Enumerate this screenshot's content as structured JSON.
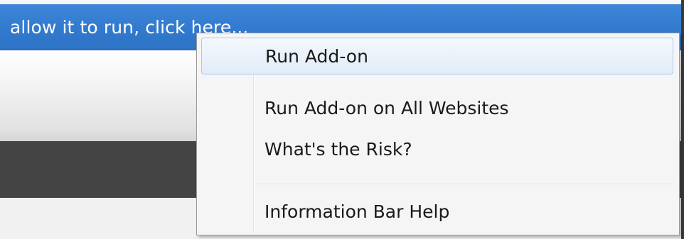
{
  "info_bar": {
    "text": "allow it to run, click here..."
  },
  "context_menu": {
    "items": [
      {
        "label": "Run Add-on"
      },
      {
        "label": "Run Add-on on All Websites"
      },
      {
        "label": "What's the Risk?"
      },
      {
        "label": "Information Bar Help"
      }
    ]
  },
  "colors": {
    "info_bar": "#3179cd",
    "menu_bg": "#f5f5f5",
    "highlight_border": "#a8c8ea",
    "dark_band": "#444444"
  }
}
